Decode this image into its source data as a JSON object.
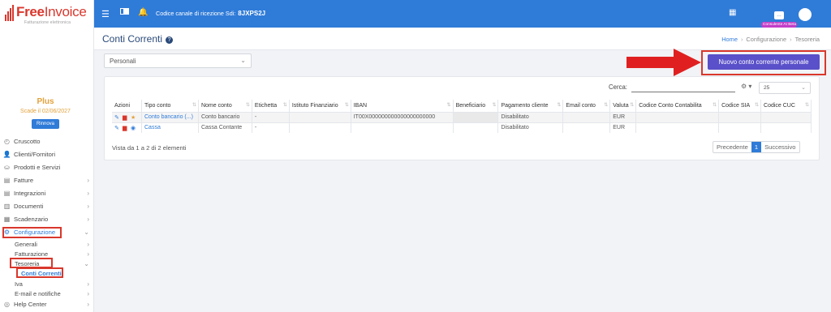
{
  "brand": {
    "name_bold": "Free",
    "name_light": "Invoice",
    "tagline": "Fatturazione elettronica"
  },
  "plan": {
    "name": "Plus",
    "expiry": "Scade il 02/06/2027",
    "renew_label": "Rinnova"
  },
  "sidebar": {
    "items": [
      {
        "label": "Cruscotto",
        "icon": "dashboard-icon"
      },
      {
        "label": "Clienti/Fornitori",
        "icon": "user-icon"
      },
      {
        "label": "Prodotti e Servizi",
        "icon": "basket-icon"
      },
      {
        "label": "Fatture",
        "icon": "file-icon"
      },
      {
        "label": "Integrazioni",
        "icon": "file-icon"
      },
      {
        "label": "Documenti",
        "icon": "documents-icon"
      },
      {
        "label": "Scadenzario",
        "icon": "calendar-icon"
      },
      {
        "label": "Configurazione",
        "icon": "gear-icon"
      }
    ],
    "config_sub": [
      "Generali",
      "Fatturazione",
      "Tesoreria"
    ],
    "tesoreria_sub": "Conti Correnti",
    "after_items": [
      {
        "label": "Iva"
      },
      {
        "label": "E-mail e notifiche"
      },
      {
        "label": "Help Center",
        "icon": "help-icon"
      }
    ]
  },
  "topbar": {
    "sdi_label": "Codice canale di ricezione Sdi:",
    "sdi_code": "8JXPS2J",
    "ai_label": "Consulente AI Beta"
  },
  "header": {
    "title": "Conti Correnti",
    "breadcrumb": [
      "Home",
      "Configurazione",
      "Tesoreria"
    ]
  },
  "filter": {
    "selected": "Personali"
  },
  "new_button": "Nuovo conto corrente personale",
  "search": {
    "label": "Cerca:",
    "page_size": "25"
  },
  "table": {
    "headers": [
      "Azioni",
      "Tipo conto",
      "Nome conto",
      "Etichetta",
      "Istituto Finanziario",
      "IBAN",
      "Beneficiario",
      "Pagamento cliente",
      "Email conto",
      "Valuta",
      "Codice Conto Contabilita",
      "Codice SIA",
      "Codice CUC"
    ],
    "rows": [
      {
        "tipo": "Conto bancario (...)",
        "nome": "Conto bancario",
        "etichetta": "-",
        "istituto": "",
        "iban": "IT00X000000000000000000000",
        "beneficiario": "",
        "pagamento": "Disabilitato",
        "email": "",
        "valuta": "EUR",
        "contab": "",
        "sia": "",
        "cuc": "",
        "extra_icon": "star-icon"
      },
      {
        "tipo": "Cassa",
        "nome": "Cassa Contante",
        "etichetta": "-",
        "istituto": "",
        "iban": "",
        "beneficiario": "",
        "pagamento": "Disabilitato",
        "email": "",
        "valuta": "EUR",
        "contab": "",
        "sia": "",
        "cuc": "",
        "extra_icon": "eye-icon"
      }
    ]
  },
  "footer": {
    "info": "Vista da 1 a 2 di 2 elementi",
    "prev": "Precedente",
    "page": "1",
    "next": "Successivo"
  },
  "colors": {
    "topbar": "#2f7bd8",
    "accent_button": "#5a50c9",
    "highlight": "#d9372c",
    "plan": "#e2a23b"
  }
}
